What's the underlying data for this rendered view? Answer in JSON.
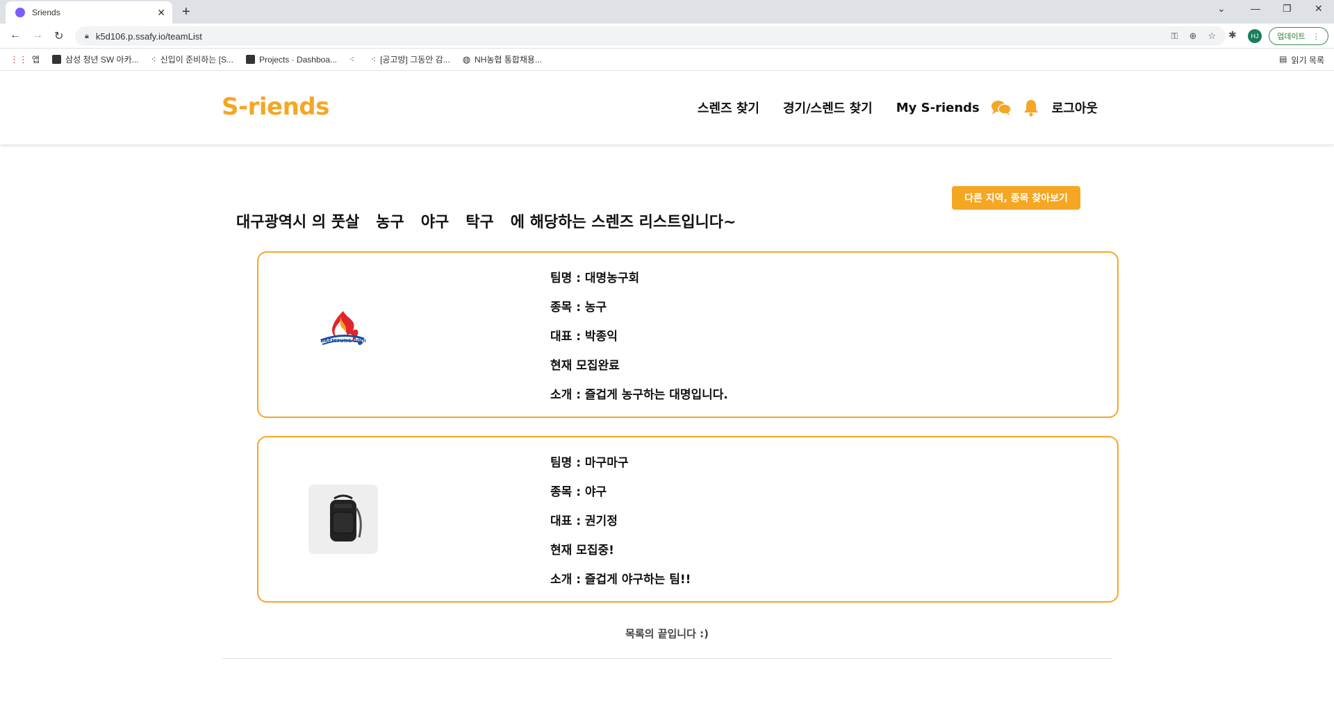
{
  "browser": {
    "tab_title": "Sriends",
    "url": "k5d106.p.ssafy.io/teamList",
    "avatar_initials": "HJ",
    "update_label": "업데이트",
    "bookmarks": [
      "앱",
      "삼성 청년 SW 아카...",
      "신입이 준비하는 [S...",
      "Projects · Dashboa...",
      "",
      "[공고방] 그동안 감...",
      "NH농협 통합채용..."
    ],
    "reading_list": "읽기 목록"
  },
  "header": {
    "logo": "S-riends",
    "nav": [
      "스렌즈 찾기",
      "경기/스렌드 찾기",
      "My S-riends",
      "로그아웃"
    ],
    "icons": [
      "chat-icon",
      "bell-icon"
    ],
    "accent": "#f5a623"
  },
  "main": {
    "find_other_label": "다른 지역, 종목 찾아보기",
    "heading": {
      "region": "대구광역시 의 풋살",
      "sports": [
        "농구",
        "야구",
        "탁구"
      ],
      "suffix": "에 해당하는 스렌즈 리스트입니다~"
    },
    "teams": [
      {
        "name": "팀명 : 대명농구회",
        "sport": "종목 : 농구",
        "leader": "대표 : 박종익",
        "status": "현재 모집완료",
        "intro": "소개 : 즐겁게 농구하는 대명입니다.",
        "logo_text": "DAEMYUNG 20th"
      },
      {
        "name": "팀명 : 마구마구",
        "sport": "종목 : 야구",
        "leader": "대표 : 권기정",
        "status": "현재 모집중!",
        "intro": "소개 : 즐겁게 야구하는 팀!!"
      }
    ],
    "end_text": "목록의 끝입니다 :)"
  }
}
